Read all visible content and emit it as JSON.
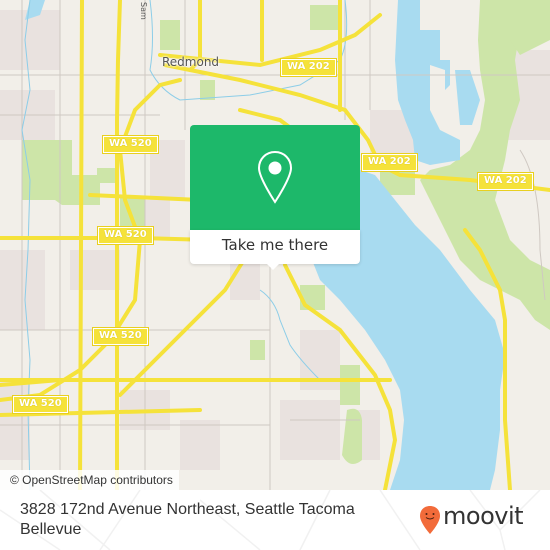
{
  "map": {
    "place_labels": [
      {
        "id": "redmond",
        "text": "Redmond"
      },
      {
        "id": "sammamish-way",
        "text": "Sam"
      }
    ],
    "route_shields": [
      {
        "id": "wa-202-north",
        "text": "WA 202"
      },
      {
        "id": "wa-520-a",
        "text": "WA 520"
      },
      {
        "id": "wa-202-east-a",
        "text": "WA 202"
      },
      {
        "id": "wa-202-east-b",
        "text": "WA 202"
      },
      {
        "id": "wa-520-b",
        "text": "WA 520"
      },
      {
        "id": "wa-520-c",
        "text": "WA 520"
      },
      {
        "id": "wa-520-d",
        "text": "WA 520"
      }
    ],
    "colors": {
      "land": "#f2efe9",
      "water": "#a8dbf0",
      "park": "#cde5a8",
      "residential": "#e9e2df",
      "major_road": "#f5e23a"
    }
  },
  "popup": {
    "icon": "location-pin-icon",
    "button_label": "Take me there",
    "accent_color": "#1db86a"
  },
  "attribution": "© OpenStreetMap contributors",
  "footer": {
    "address": "3828 172nd Avenue Northeast, Seattle Tacoma Bellevue",
    "brand": "moovit",
    "brand_color": "#f26b3a"
  }
}
